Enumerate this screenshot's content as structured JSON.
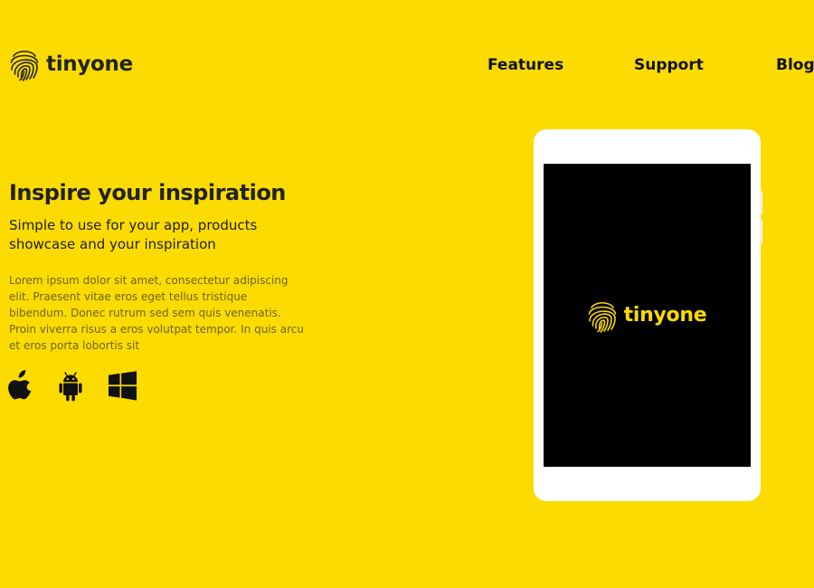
{
  "brand": {
    "name": "tinyone",
    "icon": "fingerprint-icon",
    "color": "#FCDB00"
  },
  "nav": {
    "items": [
      {
        "label": "Features"
      },
      {
        "label": "Support"
      },
      {
        "label": "Blog"
      }
    ]
  },
  "hero": {
    "title": "Inspire your inspiration",
    "subtitle": "Simple to use for your app, products showcase and your inspiration",
    "body": "Lorem ipsum dolor sit amet, consectetur adipiscing elit. Praesent vitae eros eget tellus tristique bibendum. Donec rutrum sed sem quis venenatis. Proin viverra risus a eros volutpat tempor. In quis arcu et eros porta lobortis sit"
  },
  "platforms": [
    {
      "icon": "apple-icon"
    },
    {
      "icon": "android-icon"
    },
    {
      "icon": "windows-icon"
    }
  ],
  "device": {
    "screen_brand": "tinyone",
    "screen_icon": "fingerprint-icon"
  },
  "colors": {
    "background": "#FCDB00",
    "text": "#222222",
    "muted_text": "#6D6418",
    "screen": "#000000",
    "device_frame": "#FFFFFF"
  }
}
